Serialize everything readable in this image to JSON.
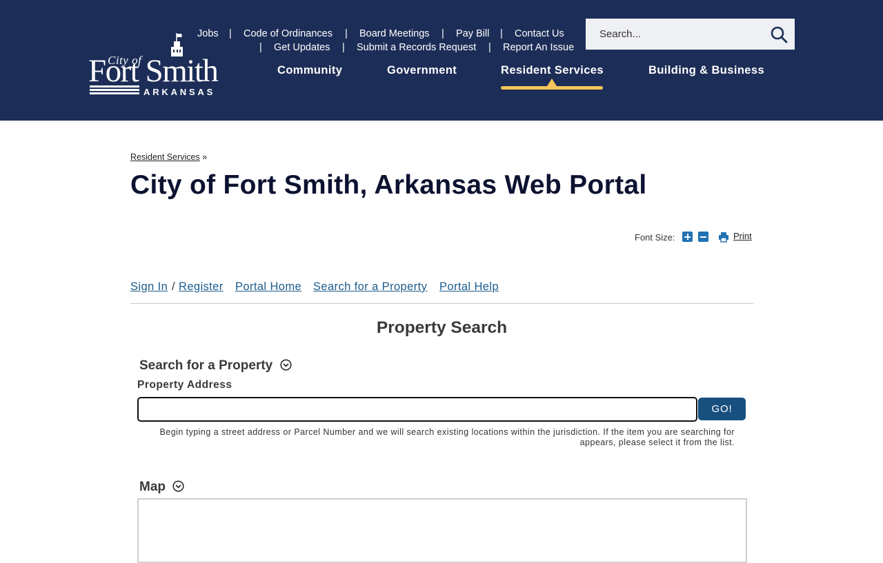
{
  "site": {
    "logo": {
      "city_of": "City of",
      "name": "Fort Smith",
      "state": "ARKANSAS"
    },
    "utility_nav": {
      "row1": [
        "Jobs",
        "Code of Ordinances",
        "Board Meetings",
        "Pay Bill",
        "Contact Us"
      ],
      "row2": [
        "Get Updates",
        "Submit a Records Request",
        "Report An Issue"
      ],
      "separator": "|"
    },
    "search": {
      "placeholder": "Search..."
    },
    "main_nav": {
      "items": [
        "Community",
        "Government",
        "Resident Services",
        "Building & Business"
      ],
      "active": "Resident Services"
    },
    "colors": {
      "header_bg": "#1c2d57",
      "accent": "#f5c559",
      "link": "#1d5c8c",
      "button": "#17507e"
    }
  },
  "breadcrumb": {
    "items": [
      "Resident Services"
    ],
    "separator": "»"
  },
  "page_title": "City of Fort Smith, Arkansas Web Portal",
  "tools": {
    "font_size_label": "Font Size:",
    "print_label": "Print"
  },
  "portal_nav": {
    "sign_in": "Sign In",
    "slash": "/",
    "register": "Register",
    "links": [
      "Portal Home",
      "Search for a Property",
      "Portal Help"
    ]
  },
  "property_search": {
    "title": "Property Search",
    "search_section": "Search for a Property",
    "address_label": "Property Address",
    "address_value": "",
    "go_label": "GO!",
    "help_text": "Begin typing a street address or Parcel Number and we will search existing locations within the jurisdiction. If the item you are searching for appears, please select it from the list.",
    "map_section": "Map"
  }
}
